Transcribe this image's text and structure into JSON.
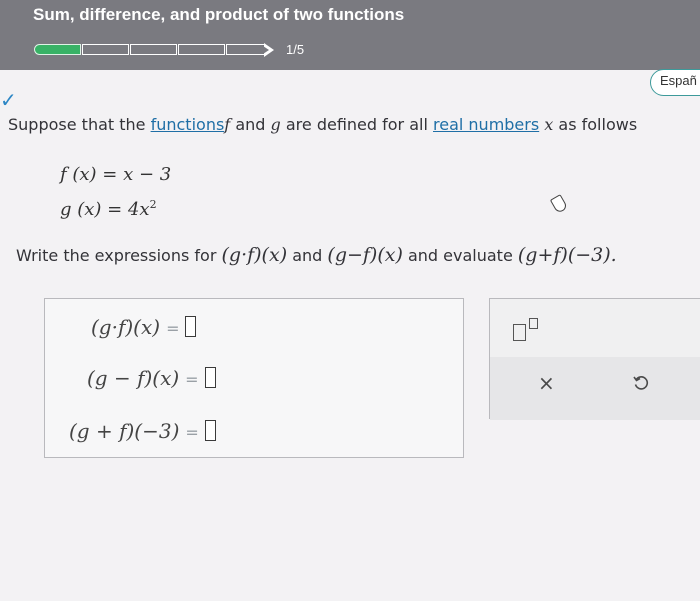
{
  "header": {
    "title": "Sum, difference, and product of two functions",
    "progress_counter": "1/5",
    "progress": {
      "completed": 1,
      "total": 5
    }
  },
  "language_button": "Españ",
  "question": {
    "intro_prefix": "Suppose that the",
    "link_functions": "functions",
    "f": "f",
    "and": "and",
    "g": "g",
    "mid": "are defined for all",
    "link_real_numbers": "real numbers",
    "x": "x",
    "suffix": "as follows",
    "f_def": "f (x) = x − 3",
    "g_def_base": "g (x) = 4x",
    "g_def_exp": "2",
    "prompt_prefix": "Write the expressions for",
    "expr1": "(g·f)(x)",
    "prompt_and": "and",
    "expr2": "(g−f)(x)",
    "prompt_mid": "and evaluate",
    "expr3": "(g+f)(−3)."
  },
  "answers": [
    {
      "label": "(g·f)(x)",
      "equals": "="
    },
    {
      "label": "(g − f)(x)",
      "equals": "="
    },
    {
      "label": "(g + f)(−3)",
      "equals": "="
    }
  ],
  "keypad": {
    "exponent_icon": "exponent-icon",
    "clear_label": "×",
    "undo_icon": "undo-icon"
  }
}
